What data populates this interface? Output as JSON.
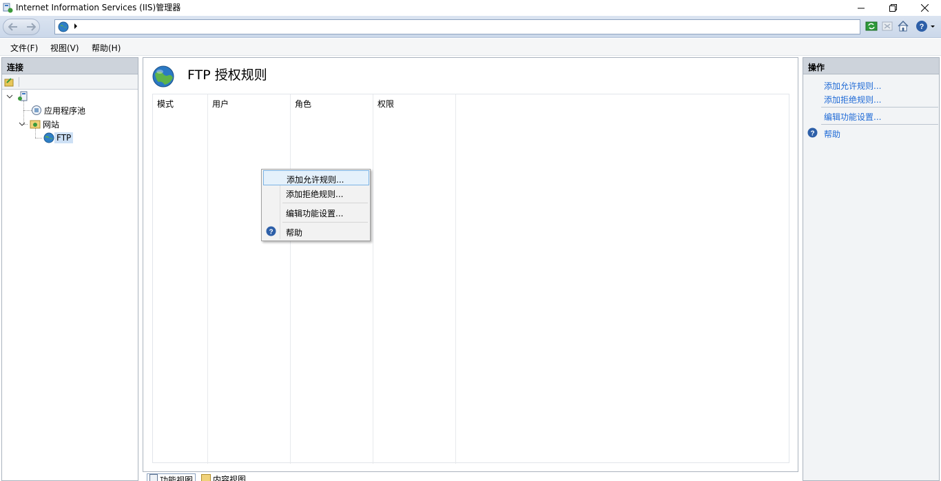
{
  "window": {
    "title": "Internet Information Services (IIS)管理器"
  },
  "menubar": {
    "items": [
      "文件(F)",
      "视图(V)",
      "帮助(H)"
    ]
  },
  "left_pane": {
    "header": "连接",
    "tree": {
      "app_pools": "应用程序池",
      "sites": "网站",
      "ftp": "FTP"
    }
  },
  "center": {
    "page_title": "FTP 授权规则",
    "columns": [
      "模式",
      "用户",
      "角色",
      "权限"
    ],
    "tabs": [
      "功能视图",
      "内容视图"
    ]
  },
  "right_pane": {
    "header": "操作",
    "actions": [
      "添加允许规则...",
      "添加拒绝规则...",
      "编辑功能设置...",
      "帮助"
    ]
  },
  "context_menu": {
    "items": [
      "添加允许规则...",
      "添加拒绝规则...",
      "编辑功能设置...",
      "帮助"
    ]
  },
  "colors": {
    "link": "#1f6ad6",
    "highlight": "#e5f1fb",
    "pane_header": "#cdd3db"
  },
  "icons": [
    "iis-app-icon",
    "back-arrow-icon",
    "forward-arrow-icon",
    "globe-icon",
    "refresh-icon",
    "stop-icon",
    "home-icon",
    "help-icon",
    "server-icon",
    "app-pool-icon",
    "sites-folder-icon",
    "ftp-globe-icon"
  ]
}
